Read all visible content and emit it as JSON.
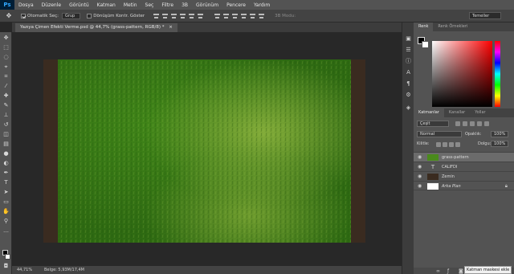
{
  "app": {
    "logo": "Ps"
  },
  "menu": [
    "Dosya",
    "Düzenle",
    "Görüntü",
    "Katman",
    "Metin",
    "Seç",
    "Filtre",
    "3B",
    "Görünüm",
    "Pencere",
    "Yardım"
  ],
  "options": {
    "auto_select_label": "Otomatik Seç:",
    "auto_select_value": "Grup",
    "transform_label": "Dönüşüm Kontr. Göster",
    "mode_3d": "3B Modu:",
    "workspace": "Temeller"
  },
  "document": {
    "tab_title": "Yazıya Çimen Efekti Verme.psd @ 44,7% (grass-pattern, RGB/8) *",
    "close_glyph": "×",
    "zoom": "44,71%",
    "doc_info": "Belge: 5,93M/17,4M"
  },
  "panels": {
    "color_tabs": [
      "Renk",
      "Renk Örnekleri"
    ],
    "layers_tabs": [
      "Katmanlar",
      "Kanallar",
      "Yollar"
    ],
    "filter_kind": "Çeşit",
    "blend_mode": "Normal",
    "opacity_label": "Opaklık:",
    "opacity_value": "100%",
    "lock_label": "Kilitle:",
    "fill_label": "Dolgu:",
    "fill_value": "100%",
    "layers": [
      {
        "name": "grass-pattern",
        "type": "image",
        "selected": true
      },
      {
        "name": "CALIFDI",
        "type": "text",
        "selected": false
      },
      {
        "name": "Zemin",
        "type": "image",
        "selected": false
      },
      {
        "name": "Arka Plan",
        "type": "background",
        "selected": false
      }
    ],
    "tooltip": "Katman maskesi ekle"
  },
  "colors": {
    "grass_dark": "#2e6a12",
    "grass_mid": "#4a8a1c",
    "grass_light": "#7fae36",
    "soil": "#3a2b20"
  },
  "icons": {
    "eye": "eye-icon",
    "lock": "lock-icon",
    "text_layer": "T"
  }
}
